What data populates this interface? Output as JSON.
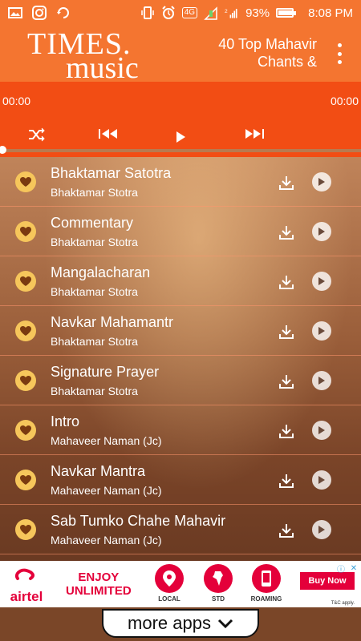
{
  "status_bar": {
    "battery": "93%",
    "time": "8:08 PM",
    "network": "4G"
  },
  "header": {
    "logo_line1": "TIMES.",
    "logo_line2": "music",
    "title": "40 Top Mahavir Chants &"
  },
  "player": {
    "elapsed": "00:00",
    "total": "00:00",
    "progress": 0
  },
  "tracks": [
    {
      "name": "Bhaktamar Satotra",
      "album": "Bhaktamar Stotra"
    },
    {
      "name": "Commentary",
      "album": "Bhaktamar Stotra"
    },
    {
      "name": "Mangalacharan",
      "album": "Bhaktamar Stotra"
    },
    {
      "name": "Navkar Mahamantr",
      "album": "Bhaktamar Stotra"
    },
    {
      "name": "Signature Prayer",
      "album": "Bhaktamar Stotra"
    },
    {
      "name": "Intro",
      "album": "Mahaveer Naman (Jc)"
    },
    {
      "name": "Navkar Mantra",
      "album": "Mahaveer Naman (Jc)"
    },
    {
      "name": "Sab Tumko Chahe Mahavir",
      "album": "Mahaveer Naman (Jc)"
    }
  ],
  "ad": {
    "brand": "airtel",
    "headline_line1": "ENJOY",
    "headline_line2": "UNLIMITED",
    "features": [
      "LOCAL",
      "STD",
      "ROAMING"
    ],
    "cta": "Buy Now",
    "tnc": "T&C apply."
  },
  "more_apps": "more apps",
  "colors": {
    "header_bg": "#f47530",
    "player_bg": "#f24d14",
    "fav_icon": "#f6c65b",
    "ad_red": "#e4003a"
  }
}
